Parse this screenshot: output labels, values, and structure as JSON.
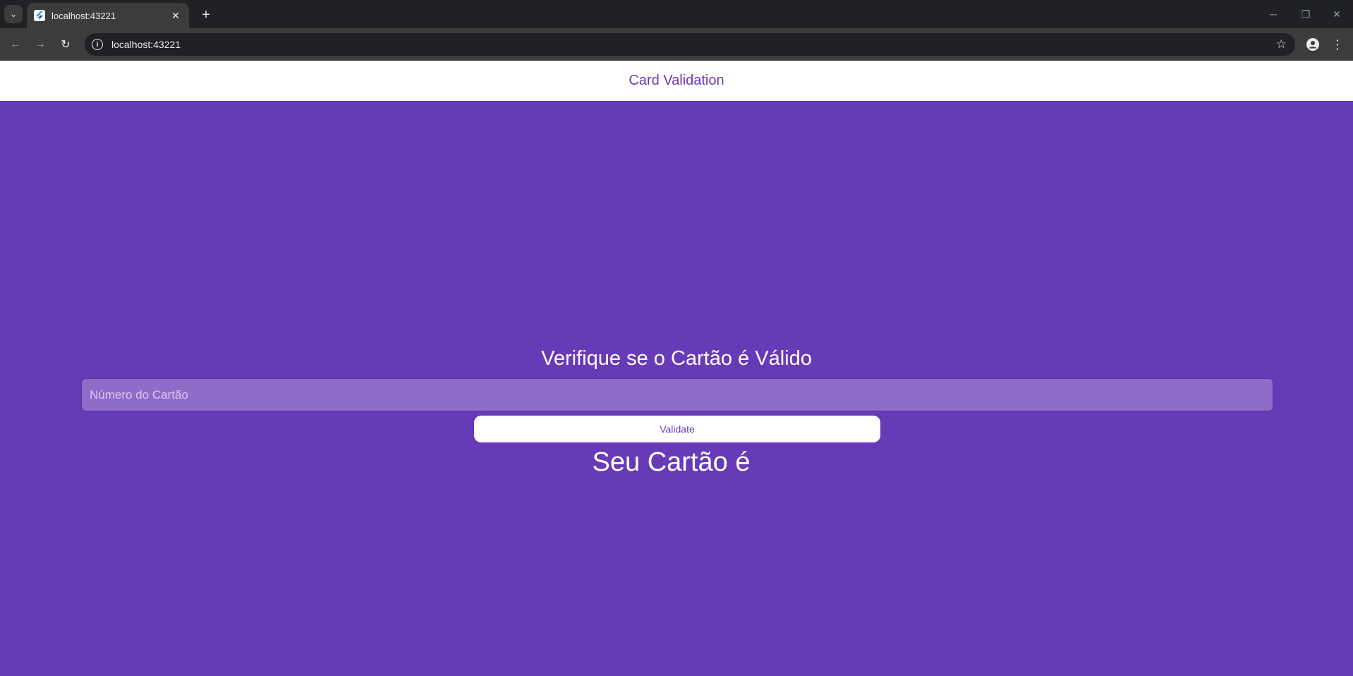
{
  "browser": {
    "tab_title": "localhost:43221",
    "url": "localhost:43221",
    "icons": {
      "tab_list": "chevron-down-icon",
      "tab_close": "close-icon",
      "new_tab": "plus-icon",
      "back": "arrow-left-icon",
      "forward": "arrow-right-icon",
      "reload": "reload-icon",
      "site_info": "info-icon",
      "bookmark": "star-icon",
      "profile": "profile-icon",
      "menu": "kebab-menu-icon"
    }
  },
  "app": {
    "title": "Card Validation",
    "heading": "Verifique se o Cartão é Válido",
    "input_placeholder": "Número do Cartão",
    "validate_label": "Validate",
    "result_text": "Seu Cartão é",
    "colors": {
      "primary": "#673ab7",
      "background": "#673ab7",
      "appbar": "#ffffff",
      "input_fill": "#8f6cc8"
    }
  }
}
